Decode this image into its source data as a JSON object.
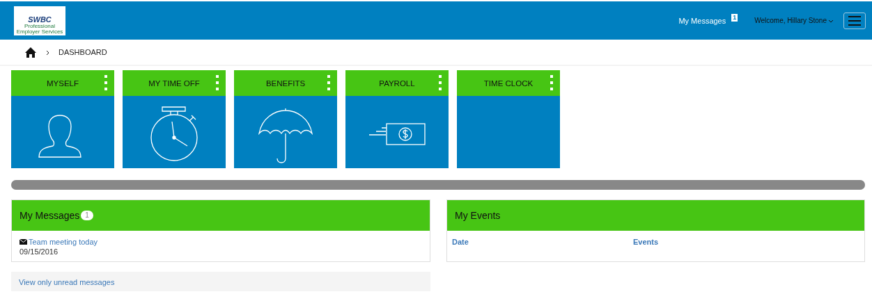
{
  "header": {
    "logo": {
      "name": "SWBC",
      "tagline_1": "Professional",
      "tagline_2": "Employer Services"
    },
    "messages_link": "My Messages",
    "messages_count": "1",
    "welcome": "Welcome, Hillary Stone"
  },
  "breadcrumb": {
    "current": "DASHBOARD"
  },
  "tiles": [
    {
      "label": "MYSELF",
      "kind": "person"
    },
    {
      "label": "MY TIME OFF",
      "kind": "stopwatch"
    },
    {
      "label": "BENEFITS",
      "kind": "umbrella"
    },
    {
      "label": "PAYROLL",
      "kind": "money"
    },
    {
      "label": "TIME CLOCK",
      "kind": "none"
    }
  ],
  "progress": {
    "level": 1
  },
  "messages_panel": {
    "title": "My Messages",
    "badge": "1",
    "messages": [
      {
        "subject": "Team meeting today",
        "date": "09/15/2016"
      }
    ],
    "footer_link": "View only unread messages"
  },
  "events_panel": {
    "title": "My Events",
    "columns": [
      "Date",
      "Events"
    ]
  }
}
